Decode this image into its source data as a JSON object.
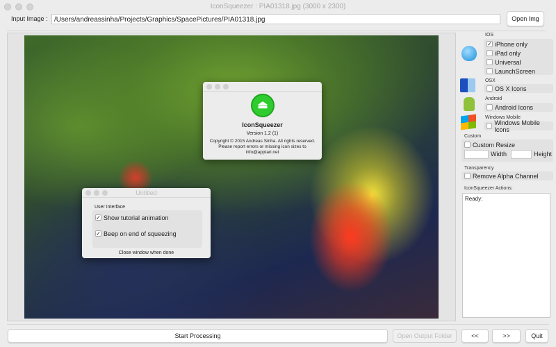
{
  "window": {
    "title": "IconSqueezer : PIA01318.jpg (3000 x 2300)"
  },
  "input": {
    "label": "Input Image :",
    "value": "/Users/andreassinha/Projects/Graphics/SpacePictures/PIA01318.jpg",
    "open_label": "Open Img"
  },
  "ios": {
    "label": "IOS",
    "options": [
      {
        "label": "iPhone only",
        "checked": true
      },
      {
        "label": "iPad only",
        "checked": false
      },
      {
        "label": "Universal",
        "checked": false
      },
      {
        "label": "LaunchScreen",
        "checked": false
      }
    ]
  },
  "osx": {
    "label": "OSX",
    "option": "OS X  Icons"
  },
  "android": {
    "label": "Android",
    "option": "Android Icons"
  },
  "windows": {
    "label": "Windows Mobile",
    "option": "Windows Mobile Icons"
  },
  "custom": {
    "label": "Custom",
    "option": "Custom  Resize",
    "width_label": "Width",
    "height_label": "Height",
    "width_value": "",
    "height_value": ""
  },
  "transparency": {
    "label": "Transparency",
    "option": "Remove Alpha Channel"
  },
  "actions": {
    "label": "IconSqueezer Actions:",
    "log": "Ready:"
  },
  "bottom": {
    "start": "Start Processing",
    "open_output": "Open Output Folder",
    "prev": "<<",
    "next": ">>",
    "quit": "Quit"
  },
  "about": {
    "name": "IconSqueezer",
    "version": "Version 1.2 (1)",
    "copyright": "Copyright © 2015 Andreas Sinha. All rights reserved.",
    "report": "Please report errors or missing icon sizes to",
    "email": "info@apptari.net",
    "accent": "#2ecc2e"
  },
  "prefs": {
    "title": "Untitled",
    "section": "User Interface",
    "options": [
      {
        "label": "Show tutorial animation",
        "checked": true
      },
      {
        "label": "Beep on end of squeezing",
        "checked": true
      }
    ],
    "footer": "Close window when done"
  }
}
